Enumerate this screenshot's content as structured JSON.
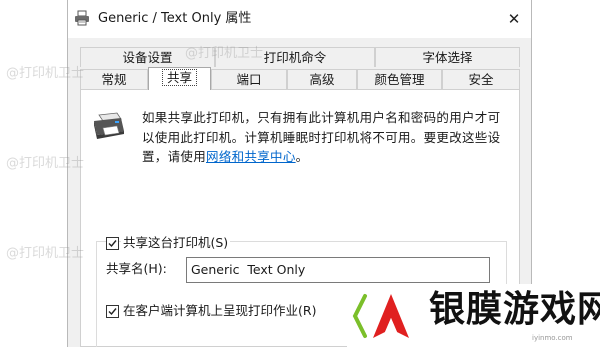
{
  "window": {
    "title": "Generic / Text Only 属性",
    "close_glyph": "✕"
  },
  "tabs_row1": [
    {
      "label": "设备设置"
    },
    {
      "label": "打印机命令"
    },
    {
      "label": "字体选择"
    }
  ],
  "tabs_row2": [
    {
      "label": "常规"
    },
    {
      "label": "共享",
      "active": true
    },
    {
      "label": "端口"
    },
    {
      "label": "高级"
    },
    {
      "label": "颜色管理"
    },
    {
      "label": "安全"
    }
  ],
  "sharing": {
    "description": "如果共享此打印机，只有拥有此计算机用户名和密码的用户才可以使用此打印机。计算机睡眠时打印机将不可用。要更改这些设置，请使用",
    "link_text": "网络和共享中心",
    "link_suffix": "。",
    "share_checkbox_label": "共享这台打印机(S)",
    "share_checkbox_checked": true,
    "share_name_label": "共享名(H):",
    "share_name_value": "Generic  Text Only",
    "render_jobs_label": "在客户端计算机上呈现打印作业(R)",
    "render_jobs_checked": true
  },
  "watermark": {
    "text": "@打印机卫士"
  },
  "logo": {
    "text": "银膜游戏网",
    "subtext": "iyinmo.com",
    "colors": {
      "red": "#e02020",
      "green": "#7bbf2a"
    }
  }
}
